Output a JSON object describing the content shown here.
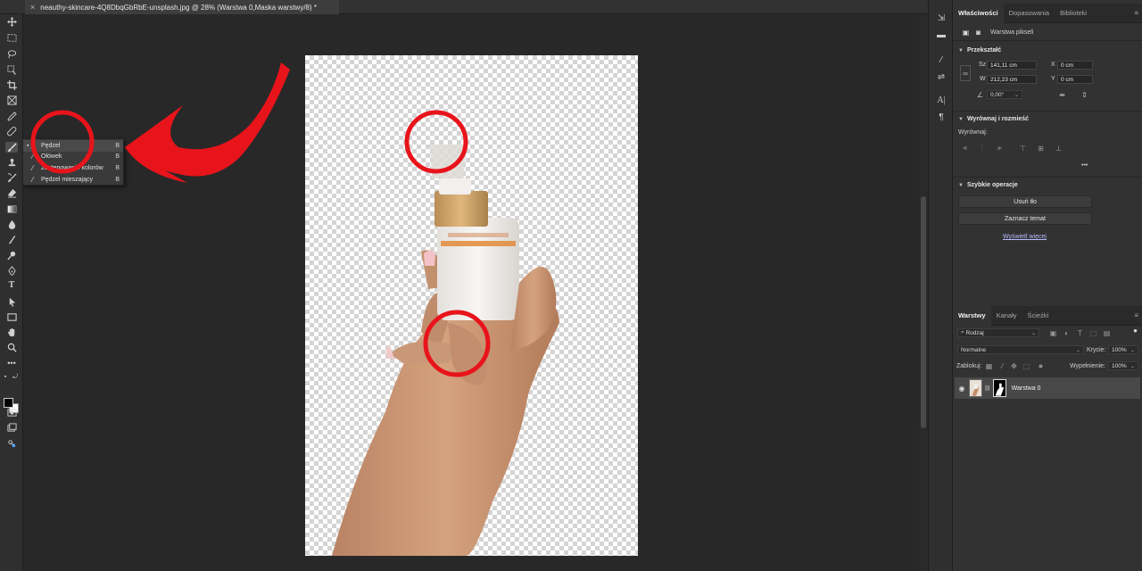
{
  "document": {
    "tab_title": "neauthy-skincare-4Q8DbqGbRbE-unsplash.jpg @ 28% (Warstwa 0,Maska warstwy/8) *",
    "close_glyph": "×"
  },
  "tool_flyout": {
    "items": [
      {
        "label": "Pędzel",
        "key": "B",
        "selected": true
      },
      {
        "label": "Ołówek",
        "key": "B",
        "selected": false
      },
      {
        "label": "Zastępowanie kolorów",
        "key": "B",
        "selected": false
      },
      {
        "label": "Pędzel mieszający",
        "key": "B",
        "selected": false
      }
    ]
  },
  "properties_panel": {
    "tabs": [
      "Właściwości",
      "Dopasowania",
      "Biblioteki"
    ],
    "active_tab": "Właściwości",
    "layer_type": "Warstwa pikseli",
    "transform": {
      "title": "Przekształć",
      "width_label": "Sz",
      "width_value": "141,11 cm",
      "height_label": "W",
      "height_value": "212,23 cm",
      "x_label": "X",
      "x_value": "0 cm",
      "y_label": "Y",
      "y_value": "0 cm",
      "angle_value": "0,00°"
    },
    "align": {
      "title": "Wyrównaj i rozmieść",
      "align_label": "Wyrównaj:",
      "more_glyph": "•••"
    },
    "quick_actions": {
      "title": "Szybkie operacje",
      "remove_bg": "Usuń tło",
      "select_subject": "Zaznacz temat",
      "show_more": "Wyświetl więcej"
    }
  },
  "layers_panel": {
    "tabs": [
      "Warstwy",
      "Kanały",
      "Ścieżki"
    ],
    "active_tab": "Warstwy",
    "filter_label": "Rodzaj",
    "blend_mode": "Normalne",
    "opacity_label": "Krycie:",
    "opacity_value": "100%",
    "lock_label": "Zablokuj:",
    "fill_label": "Wypełnienie:",
    "fill_value": "100%",
    "layers": [
      {
        "name": "Warstwa 0",
        "visible": true
      }
    ]
  },
  "colors": {
    "annotation_red": "#e8141b",
    "foreground": "#000000",
    "background": "#ffffff"
  }
}
